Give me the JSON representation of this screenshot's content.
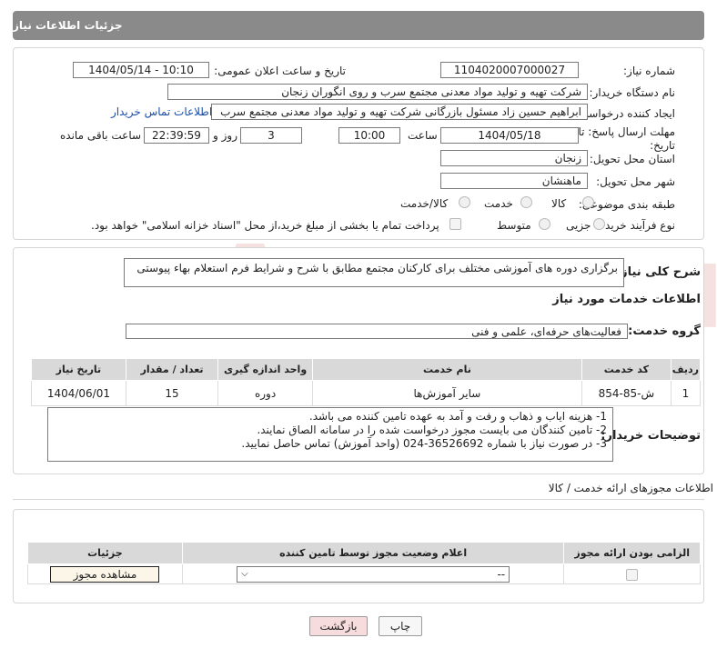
{
  "header": {
    "title": "جزئیات اطلاعات نیاز"
  },
  "form": {
    "need_number_label": "شماره نیاز:",
    "need_number_value": "1104020007000027",
    "announce_label": "تاریخ و ساعت اعلان عمومی:",
    "announce_value": "1404/05/14 - 10:10",
    "buyer_org_label": "نام دستگاه خریدار:",
    "buyer_org_value": "شرکت تهیه و تولید مواد معدنی مجتمع سرب و روی انگوران   زنجان",
    "creator_label": "ایجاد کننده درخواست:",
    "creator_value": "ابراهیم حسین زاد مسئول بازرگانی شرکت تهیه و تولید مواد معدنی مجتمع سرب",
    "buyer_contact_link": "اطلاعات تماس خریدار",
    "deadline_label_1": "مهلت ارسال پاسخ: تا",
    "deadline_label_2": "تاریخ:",
    "deadline_date": "1404/05/18",
    "time_label": "ساعت",
    "deadline_time": "10:00",
    "days_value": "3",
    "days_label": "روز و",
    "remaining_time": "22:39:59",
    "remaining_label": "ساعت باقی مانده",
    "province_label": "استان محل تحویل:",
    "province_value": "زنجان",
    "city_label": "شهر محل تحویل:",
    "city_value": "ماهنشان",
    "category_label": "طبقه بندی موضوعی:",
    "category_options": [
      "کالا",
      "خدمت",
      "کالا/خدمت"
    ],
    "purchase_type_label": "نوع فرآیند خرید :",
    "purchase_type_options": [
      "جزیی",
      "متوسط"
    ],
    "payment_note": "پرداخت تمام یا بخشی از مبلغ خرید،از محل \"اسناد خزانه اسلامی\" خواهد بود."
  },
  "summary": {
    "label": "شرح کلی نیاز:",
    "value": "برگزاری دوره های آموزشی مختلف برای کارکنان مجتمع مطابق با شرح و شرایط فرم استعلام بهاء پیوستی"
  },
  "services": {
    "section_title": "اطلاعات خدمات مورد نیاز",
    "group_label": "گروه خدمت:",
    "group_value": "فعالیت‌های حرفه‌ای، علمی و فنی",
    "columns": [
      "ردیف",
      "کد خدمت",
      "نام خدمت",
      "واحد اندازه گیری",
      "تعداد / مقدار",
      "تاریخ نیاز"
    ],
    "rows": [
      [
        "1",
        "ش-85-854",
        "سایر آموزش‌ها",
        "دوره",
        "15",
        "1404/06/01"
      ]
    ]
  },
  "buyer_notes": {
    "label": "توضیحات خریدار:",
    "lines": [
      "1- هزینه ایاب و ذهاب و رفت و آمد به عهده تامین کننده می باشد.",
      "2- تامین کنندگان می بایست مجوز درخواست شده را در سامانه الصاق نمایند.",
      "3- در صورت نیاز با شماره 36526692-024 (واحد آموزش) تماس حاصل نمایید."
    ]
  },
  "permits": {
    "section_title": "اطلاعات مجوزهای ارائه خدمت / کالا",
    "columns": [
      "الزامی بودن ارائه مجوز",
      "اعلام وضعیت مجوز توسط تامین کننده",
      "جزئیات"
    ],
    "select_value": "--",
    "view_button": "مشاهده مجوز"
  },
  "footer": {
    "print_button": "چاپ",
    "back_button": "بازگشت"
  },
  "watermark": {
    "text": "AriaTender.neT"
  },
  "colors": {
    "header_bg": "#8a8a8a",
    "link": "#1a4ea8",
    "back_button_bg": "#f6dcdc",
    "watermark": "#c0392b"
  }
}
